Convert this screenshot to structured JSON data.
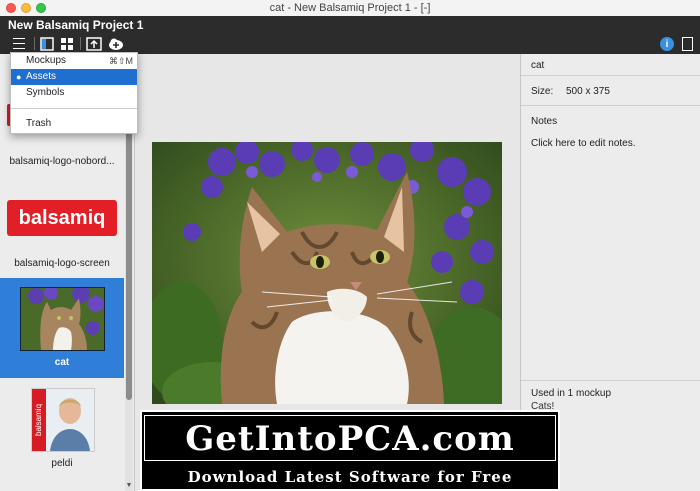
{
  "window": {
    "title": "cat - New Balsamiq Project 1 - [-]"
  },
  "header": {
    "project_name": "New Balsamiq Project 1"
  },
  "menu": {
    "items": [
      {
        "label": "Mockups",
        "shortcut": "⌘⇧M"
      },
      {
        "label": "Assets",
        "selected": true
      },
      {
        "label": "Symbols"
      },
      {
        "label": "Trash"
      }
    ]
  },
  "assets": {
    "items": [
      {
        "label": "balsamiq-logo-nobord..."
      },
      {
        "label": "balsamiq-logo-screen",
        "logo_text": "balsamiq"
      },
      {
        "label": "cat",
        "selected": true
      },
      {
        "label": "peldi",
        "badge_text": "balsamiq"
      }
    ]
  },
  "inspector": {
    "title": "cat",
    "size_label": "Size:",
    "size_value": "500 x 375",
    "notes_label": "Notes",
    "notes_placeholder": "Click here to edit notes.",
    "usage_text": "Used in 1 mockup",
    "usage_link": "Cats!"
  },
  "watermark": {
    "title": "GetIntoPCA.com",
    "subtitle": "Download Latest Software for Free"
  },
  "colors": {
    "accent": "#2f7ed8",
    "header_bg": "#2c2c2c",
    "brand_red": "#e21f26"
  }
}
